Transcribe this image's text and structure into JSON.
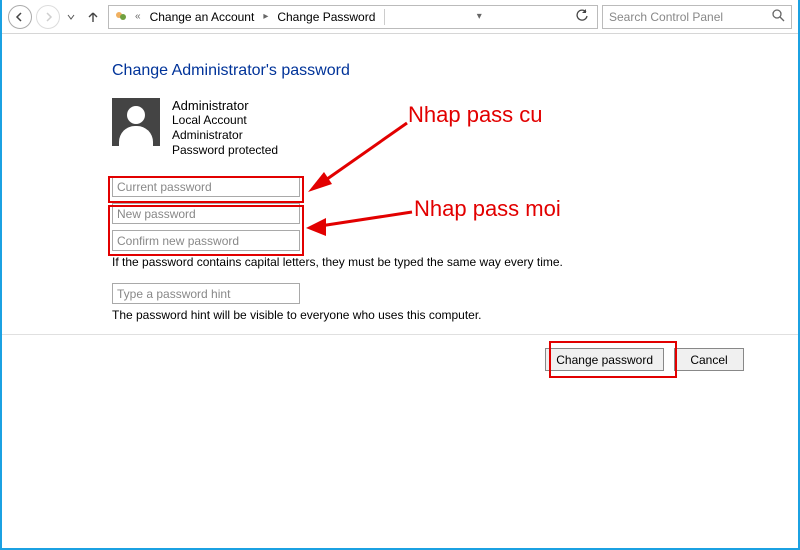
{
  "toolbar": {
    "breadcrumb_parent": "Change an Account",
    "breadcrumb_current": "Change Password",
    "search_placeholder": "Search Control Panel"
  },
  "page": {
    "heading": "Change Administrator's password"
  },
  "account": {
    "name": "Administrator",
    "type_line": "Local Account",
    "role_line": "Administrator",
    "protection_line": "Password protected"
  },
  "fields": {
    "current_placeholder": "Current password",
    "new_placeholder": "New password",
    "confirm_placeholder": "Confirm new password",
    "caps_note": "If the password contains capital letters, they must be typed the same way every time.",
    "hint_placeholder": "Type a password hint",
    "hint_note": "The password hint will be visible to everyone who uses this computer."
  },
  "buttons": {
    "change": "Change password",
    "cancel": "Cancel"
  },
  "annotations": {
    "label_old": "Nhap pass cu",
    "label_new": "Nhap pass moi",
    "color": "#e20000"
  }
}
